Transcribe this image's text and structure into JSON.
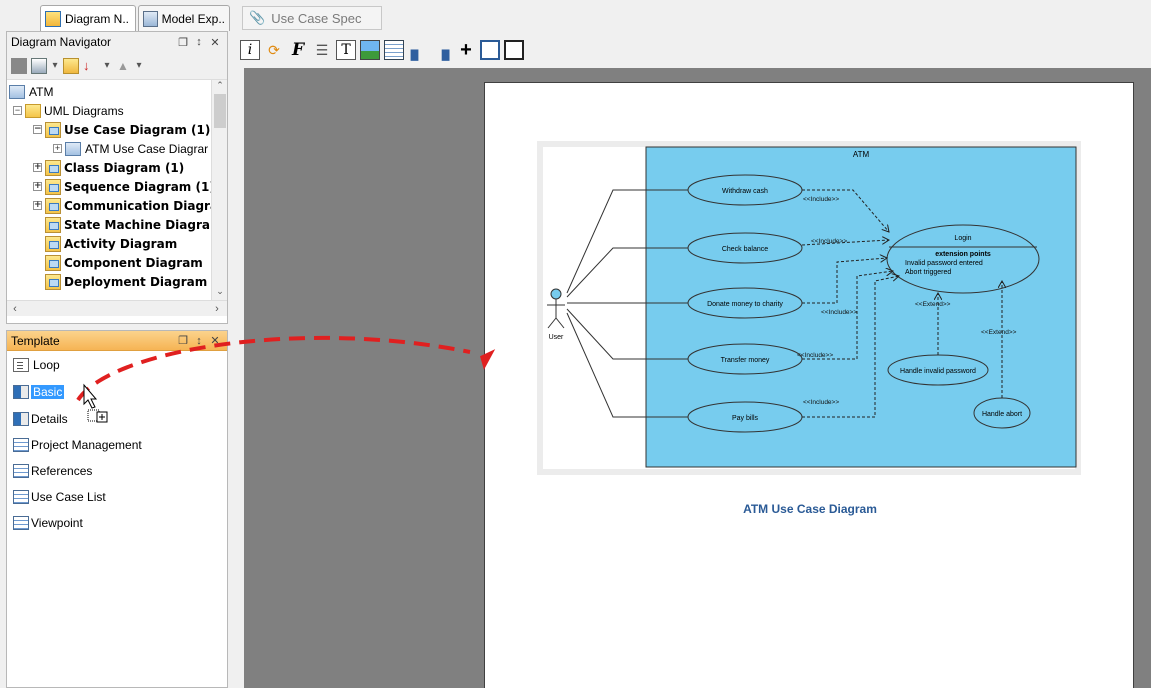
{
  "left_tabs": [
    "Diagram N..",
    "Model Exp.."
  ],
  "navigator": {
    "title": "Diagram Navigator",
    "tree": [
      {
        "label": "ATM",
        "kind": "root"
      },
      {
        "label": "UML Diagrams",
        "kind": "folder"
      },
      {
        "label": "Use Case Diagram (1)",
        "kind": "diagram",
        "bold": true
      },
      {
        "label": "ATM Use Case Diagrar",
        "kind": "item"
      },
      {
        "label": "Class Diagram (1)",
        "kind": "diagram",
        "bold": true
      },
      {
        "label": "Sequence Diagram (1)",
        "kind": "diagram",
        "bold": true
      },
      {
        "label": "Communication Diagra",
        "kind": "diagram",
        "bold": true
      },
      {
        "label": "State Machine Diagrai",
        "kind": "diagram",
        "bold": true
      },
      {
        "label": "Activity Diagram",
        "kind": "diagram",
        "bold": true
      },
      {
        "label": "Component Diagram",
        "kind": "diagram",
        "bold": true
      },
      {
        "label": "Deployment Diagram",
        "kind": "diagram",
        "bold": true
      }
    ]
  },
  "template_panel": {
    "title": "Template",
    "items": [
      "Loop",
      "Basic",
      "Details",
      "Project Management",
      "References",
      "Use Case List",
      "Viewpoint"
    ],
    "selected": "Basic"
  },
  "editor": {
    "tab_label": "Use Case Spec",
    "toolbar_icons": [
      "info-icon",
      "refresh-icon",
      "font-icon",
      "list-icon",
      "text-icon",
      "image-icon",
      "table-icon",
      "page-break-icon",
      "page-break-alt-icon",
      "add-icon",
      "page-icon",
      "page-outline-icon"
    ],
    "caption": "ATM Use Case Diagram"
  },
  "diagram": {
    "system_name": "ATM",
    "actor": "User",
    "use_cases": [
      "Withdraw cash",
      "Check balance",
      "Donate money to charity",
      "Transfer money",
      "Pay bills"
    ],
    "login": {
      "name": "Login",
      "ext_title": "extension points",
      "ext1": "Invalid password entered",
      "ext2": "Abort triggered"
    },
    "extensions": [
      "Handle invalid password",
      "Handle abort"
    ],
    "include_label": "<<Include>>",
    "extend_label": "<<Extend>>"
  },
  "colors": {
    "system_fill": "#77ccee",
    "drag_arrow": "#e02020",
    "selection": "#3399ff"
  }
}
